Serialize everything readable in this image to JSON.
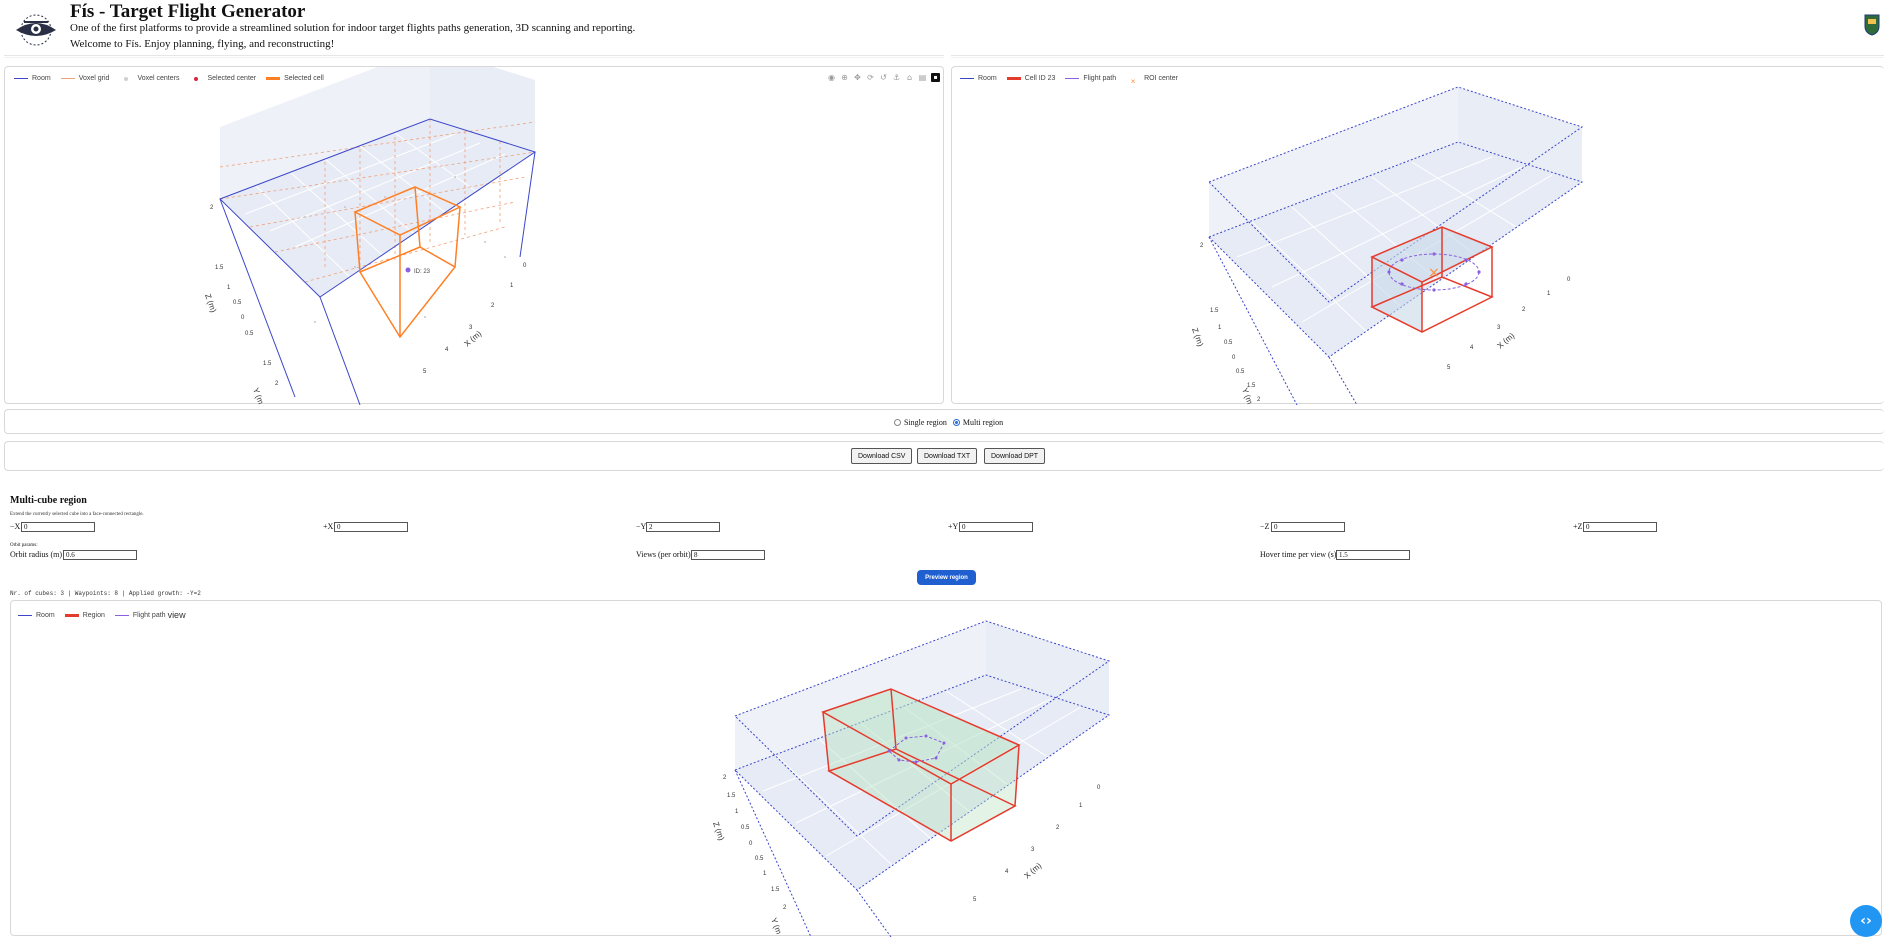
{
  "header": {
    "title": "Fís - Target Flight Generator",
    "tagline": "One of the first platforms to provide a streamlined solution for indoor target flights paths generation, 3D scanning and reporting.",
    "welcome": "Welcome to Fís. Enjoy planning, flying, and reconstructing!"
  },
  "plot_left": {
    "legend": [
      {
        "label": "Room",
        "color": "#3b46c9"
      },
      {
        "label": "Voxel grid",
        "color": "#f0a07a"
      },
      {
        "label": "Voxel centers",
        "color": "#bdbdbd"
      },
      {
        "label": "Selected center",
        "color": "#d7283e"
      },
      {
        "label": "Selected cell",
        "color": "#ff7f24"
      }
    ],
    "toolbar_icons": [
      "camera-icon",
      "zoom-icon",
      "pan-icon",
      "orbit-rotation-icon",
      "turntable-rotation-icon",
      "reset-camera-icon",
      "home-icon",
      "plotly-logo-icon"
    ],
    "point_label": "ID: 23",
    "z_axis_title": "Z (m)",
    "y_axis_title": "Y (m",
    "x_axis_title": "X (m)",
    "z_ticks": [
      "2",
      "1.5",
      "1",
      "0.5",
      "0",
      "0.5",
      "1.5",
      "2"
    ],
    "x_ticks": [
      "0",
      "1",
      "2",
      "3",
      "4",
      "5"
    ]
  },
  "plot_right": {
    "legend": [
      {
        "label": "Room",
        "color": "#3b46c9"
      },
      {
        "label": "Cell ID 23",
        "color": "#e53b2c"
      },
      {
        "label": "Flight path",
        "color": "#8a5fe0"
      },
      {
        "label": "ROI center",
        "color": "#ff8c3a"
      }
    ],
    "z_axis_title": "Z (m)",
    "y_axis_title": "Y (m",
    "x_axis_title": "X (m)",
    "z_ticks": [
      "2",
      "1.5",
      "1",
      "0.5",
      "0",
      "0.5",
      "1.5",
      "2"
    ],
    "x_ticks": [
      "0",
      "1",
      "2",
      "3",
      "4",
      "5"
    ]
  },
  "mode": {
    "options": [
      "Single region",
      "Multi region"
    ],
    "selected": "Multi region"
  },
  "downloads": {
    "csv": "Download CSV",
    "txt": "Download TXT",
    "dpt": "Download DPT"
  },
  "multi_cube": {
    "title": "Multi-cube region",
    "description": "Extend the currently selected cube into a face-connected rectangle.",
    "growth_fields": [
      {
        "label": "−X",
        "value": "0"
      },
      {
        "label": "+X",
        "value": "0"
      },
      {
        "label": "−Y",
        "value": "2"
      },
      {
        "label": "+Y",
        "value": "0"
      },
      {
        "label": "−Z",
        "value": "0"
      },
      {
        "label": "+Z",
        "value": "0"
      }
    ],
    "orbit_label": "Orbit params:",
    "orbit_fields": [
      {
        "label": "Orbit radius (m)",
        "value": "0.6"
      },
      {
        "label": "Views (per orbit)",
        "value": "8"
      },
      {
        "label": "Hover time per view (s)",
        "value": "1.5"
      }
    ],
    "preview_button": "Preview region",
    "status": "Nr. of cubes: 3 | Waypoints: 8 | Applied growth: -Y=2"
  },
  "plot_bottom": {
    "legend": [
      {
        "label": "Room",
        "color": "#3b46c9"
      },
      {
        "label": "Region",
        "color": "#e53b2c"
      },
      {
        "label": "Flight path",
        "color": "#8a5fe0"
      }
    ],
    "legend_trailing": "view",
    "z_axis_title": "Z (m)",
    "y_axis_title": "Y (m",
    "x_axis_title": "X (m)",
    "z_ticks": [
      "2",
      "1.5",
      "1",
      "0.5",
      "0",
      "0.5",
      "1",
      "1.5",
      "2"
    ],
    "x_ticks": [
      "0",
      "1",
      "2",
      "3",
      "4",
      "5"
    ]
  },
  "fab": {
    "icon": "code-toggle-icon",
    "glyph": "‹›"
  }
}
